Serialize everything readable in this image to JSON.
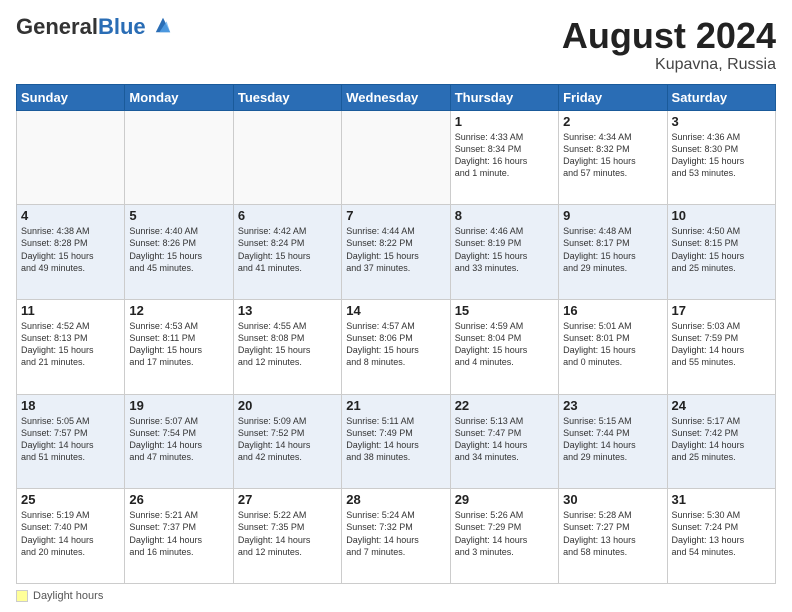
{
  "header": {
    "logo_general": "General",
    "logo_blue": "Blue",
    "month_title": "August 2024",
    "location": "Kupavna, Russia"
  },
  "footer": {
    "label": "Daylight hours"
  },
  "weekdays": [
    "Sunday",
    "Monday",
    "Tuesday",
    "Wednesday",
    "Thursday",
    "Friday",
    "Saturday"
  ],
  "weeks": [
    [
      {
        "day": "",
        "info": ""
      },
      {
        "day": "",
        "info": ""
      },
      {
        "day": "",
        "info": ""
      },
      {
        "day": "",
        "info": ""
      },
      {
        "day": "1",
        "info": "Sunrise: 4:33 AM\nSunset: 8:34 PM\nDaylight: 16 hours\nand 1 minute."
      },
      {
        "day": "2",
        "info": "Sunrise: 4:34 AM\nSunset: 8:32 PM\nDaylight: 15 hours\nand 57 minutes."
      },
      {
        "day": "3",
        "info": "Sunrise: 4:36 AM\nSunset: 8:30 PM\nDaylight: 15 hours\nand 53 minutes."
      }
    ],
    [
      {
        "day": "4",
        "info": "Sunrise: 4:38 AM\nSunset: 8:28 PM\nDaylight: 15 hours\nand 49 minutes."
      },
      {
        "day": "5",
        "info": "Sunrise: 4:40 AM\nSunset: 8:26 PM\nDaylight: 15 hours\nand 45 minutes."
      },
      {
        "day": "6",
        "info": "Sunrise: 4:42 AM\nSunset: 8:24 PM\nDaylight: 15 hours\nand 41 minutes."
      },
      {
        "day": "7",
        "info": "Sunrise: 4:44 AM\nSunset: 8:22 PM\nDaylight: 15 hours\nand 37 minutes."
      },
      {
        "day": "8",
        "info": "Sunrise: 4:46 AM\nSunset: 8:19 PM\nDaylight: 15 hours\nand 33 minutes."
      },
      {
        "day": "9",
        "info": "Sunrise: 4:48 AM\nSunset: 8:17 PM\nDaylight: 15 hours\nand 29 minutes."
      },
      {
        "day": "10",
        "info": "Sunrise: 4:50 AM\nSunset: 8:15 PM\nDaylight: 15 hours\nand 25 minutes."
      }
    ],
    [
      {
        "day": "11",
        "info": "Sunrise: 4:52 AM\nSunset: 8:13 PM\nDaylight: 15 hours\nand 21 minutes."
      },
      {
        "day": "12",
        "info": "Sunrise: 4:53 AM\nSunset: 8:11 PM\nDaylight: 15 hours\nand 17 minutes."
      },
      {
        "day": "13",
        "info": "Sunrise: 4:55 AM\nSunset: 8:08 PM\nDaylight: 15 hours\nand 12 minutes."
      },
      {
        "day": "14",
        "info": "Sunrise: 4:57 AM\nSunset: 8:06 PM\nDaylight: 15 hours\nand 8 minutes."
      },
      {
        "day": "15",
        "info": "Sunrise: 4:59 AM\nSunset: 8:04 PM\nDaylight: 15 hours\nand 4 minutes."
      },
      {
        "day": "16",
        "info": "Sunrise: 5:01 AM\nSunset: 8:01 PM\nDaylight: 15 hours\nand 0 minutes."
      },
      {
        "day": "17",
        "info": "Sunrise: 5:03 AM\nSunset: 7:59 PM\nDaylight: 14 hours\nand 55 minutes."
      }
    ],
    [
      {
        "day": "18",
        "info": "Sunrise: 5:05 AM\nSunset: 7:57 PM\nDaylight: 14 hours\nand 51 minutes."
      },
      {
        "day": "19",
        "info": "Sunrise: 5:07 AM\nSunset: 7:54 PM\nDaylight: 14 hours\nand 47 minutes."
      },
      {
        "day": "20",
        "info": "Sunrise: 5:09 AM\nSunset: 7:52 PM\nDaylight: 14 hours\nand 42 minutes."
      },
      {
        "day": "21",
        "info": "Sunrise: 5:11 AM\nSunset: 7:49 PM\nDaylight: 14 hours\nand 38 minutes."
      },
      {
        "day": "22",
        "info": "Sunrise: 5:13 AM\nSunset: 7:47 PM\nDaylight: 14 hours\nand 34 minutes."
      },
      {
        "day": "23",
        "info": "Sunrise: 5:15 AM\nSunset: 7:44 PM\nDaylight: 14 hours\nand 29 minutes."
      },
      {
        "day": "24",
        "info": "Sunrise: 5:17 AM\nSunset: 7:42 PM\nDaylight: 14 hours\nand 25 minutes."
      }
    ],
    [
      {
        "day": "25",
        "info": "Sunrise: 5:19 AM\nSunset: 7:40 PM\nDaylight: 14 hours\nand 20 minutes."
      },
      {
        "day": "26",
        "info": "Sunrise: 5:21 AM\nSunset: 7:37 PM\nDaylight: 14 hours\nand 16 minutes."
      },
      {
        "day": "27",
        "info": "Sunrise: 5:22 AM\nSunset: 7:35 PM\nDaylight: 14 hours\nand 12 minutes."
      },
      {
        "day": "28",
        "info": "Sunrise: 5:24 AM\nSunset: 7:32 PM\nDaylight: 14 hours\nand 7 minutes."
      },
      {
        "day": "29",
        "info": "Sunrise: 5:26 AM\nSunset: 7:29 PM\nDaylight: 14 hours\nand 3 minutes."
      },
      {
        "day": "30",
        "info": "Sunrise: 5:28 AM\nSunset: 7:27 PM\nDaylight: 13 hours\nand 58 minutes."
      },
      {
        "day": "31",
        "info": "Sunrise: 5:30 AM\nSunset: 7:24 PM\nDaylight: 13 hours\nand 54 minutes."
      }
    ]
  ]
}
